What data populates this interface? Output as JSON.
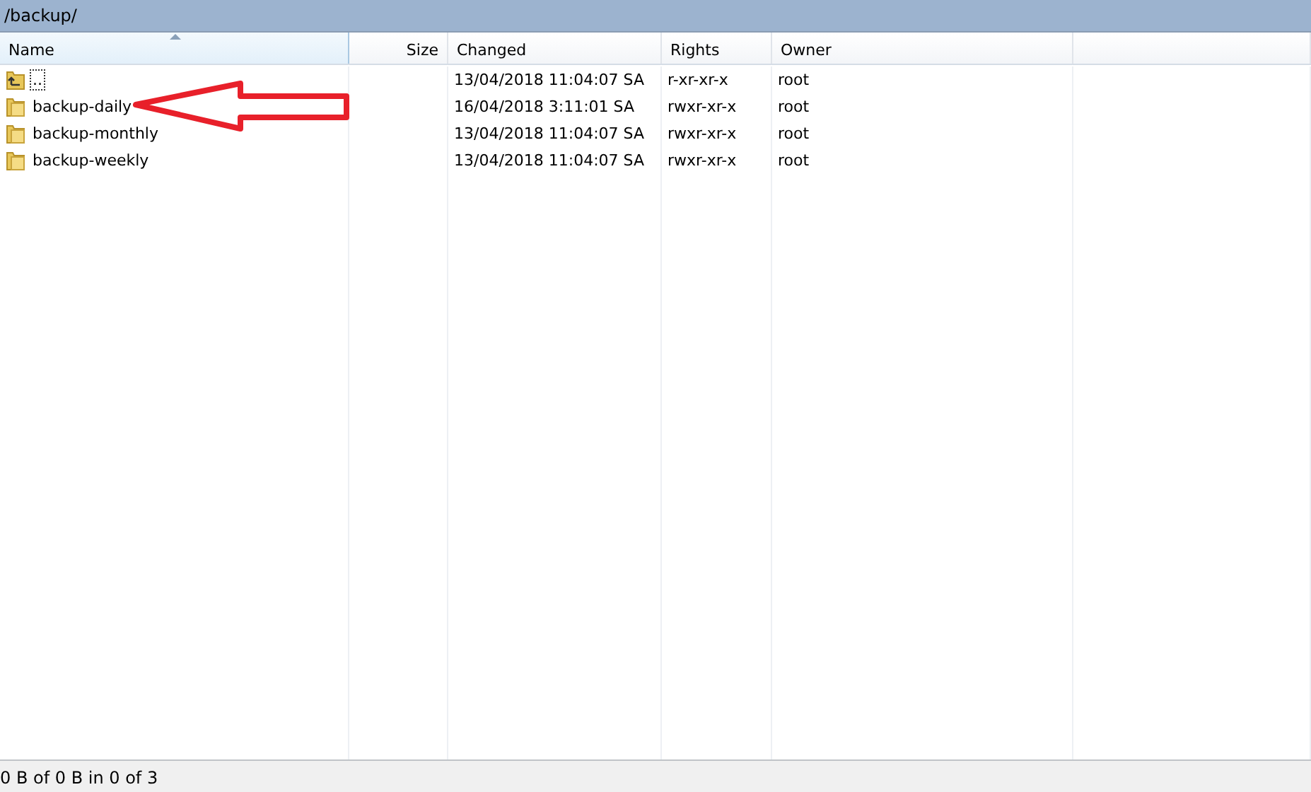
{
  "path": "/backup/",
  "columns": [
    {
      "label": "Name",
      "sorted": true
    },
    {
      "label": "Size",
      "sorted": false
    },
    {
      "label": "Changed",
      "sorted": false
    },
    {
      "label": "Rights",
      "sorted": false
    },
    {
      "label": "Owner",
      "sorted": false
    }
  ],
  "rows": [
    {
      "kind": "parent",
      "name": "..",
      "changed": "13/04/2018 11:04:07 SA",
      "rights": "r-xr-xr-x",
      "owner": "root",
      "focused": true
    },
    {
      "kind": "folder",
      "name": "backup-daily",
      "changed": "16/04/2018 3:11:01 SA",
      "rights": "rwxr-xr-x",
      "owner": "root",
      "focused": false
    },
    {
      "kind": "folder",
      "name": "backup-monthly",
      "changed": "13/04/2018 11:04:07 SA",
      "rights": "rwxr-xr-x",
      "owner": "root",
      "focused": false
    },
    {
      "kind": "folder",
      "name": "backup-weekly",
      "changed": "13/04/2018 11:04:07 SA",
      "rights": "rwxr-xr-x",
      "owner": "root",
      "focused": false
    }
  ],
  "status_bar": "0 B of 0 B in 0 of 3"
}
